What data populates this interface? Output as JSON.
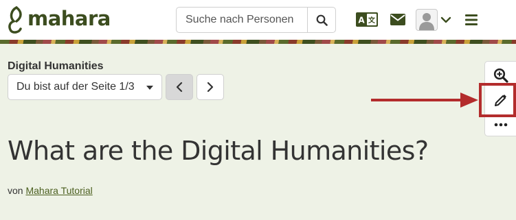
{
  "header": {
    "logo_text": "mahara",
    "search": {
      "placeholder": "Suche nach Personen"
    },
    "icons": {
      "search": "search-icon",
      "language": "language-switch-icon",
      "messages": "envelope-icon",
      "user": "user-avatar",
      "user_menu": "chevron-down-icon",
      "main_menu": "hamburger-menu-icon"
    }
  },
  "collection": {
    "title": "Digital Humanities",
    "page_selector": "Du bist auf der Seite 1/3"
  },
  "toolbar": {
    "items": [
      "zoom-in-icon",
      "pencil-icon",
      "more-icon"
    ]
  },
  "page": {
    "heading": "What are the Digital Humanities?",
    "byline_prefix": "von",
    "author": "Mahara Tutorial"
  },
  "colors": {
    "brand": "#3c4d1f",
    "background": "#eef2e6",
    "highlight": "#b32c2c"
  }
}
